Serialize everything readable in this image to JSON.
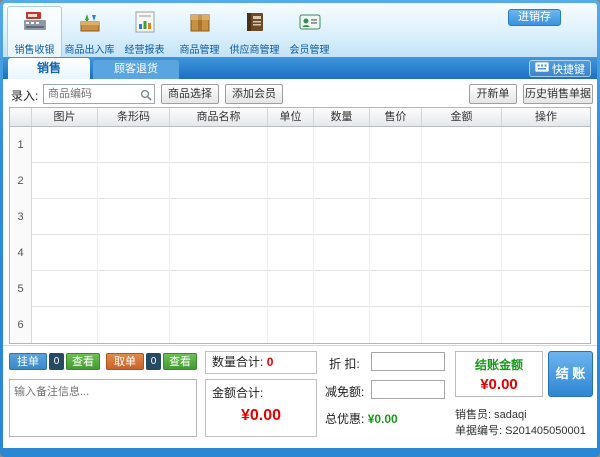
{
  "titlebar": {
    "inventory_button": "进销存"
  },
  "toolbar": {
    "items": [
      {
        "label": "销售收银",
        "icon": "cash-register-icon"
      },
      {
        "label": "商品出入库",
        "icon": "stock-inout-icon"
      },
      {
        "label": "经营报表",
        "icon": "report-icon"
      },
      {
        "label": "商品管理",
        "icon": "product-box-icon"
      },
      {
        "label": "供应商管理",
        "icon": "supplier-icon"
      },
      {
        "label": "会员管理",
        "icon": "member-card-icon"
      }
    ]
  },
  "tabs": {
    "sales": "销售",
    "returns": "顾客退货",
    "shortcut": "快捷键"
  },
  "entry": {
    "label": "录入:",
    "placeholder": "商品编码",
    "select_product": "商品选择",
    "add_member": "添加会员",
    "new_order": "开新单",
    "history": "历史销售单据"
  },
  "table": {
    "headers": [
      "图片",
      "条形码",
      "商品名称",
      "单位",
      "数量",
      "售价",
      "金额",
      "操作"
    ],
    "row_numbers": [
      "1",
      "2",
      "3",
      "4",
      "5",
      "6"
    ]
  },
  "footer": {
    "hold": {
      "label": "挂单",
      "count": "0",
      "view": "查看"
    },
    "retrieve": {
      "label": "取单",
      "count": "0",
      "view": "查看"
    },
    "remark_placeholder": "输入备注信息...",
    "qty_total_label": "数量合计:",
    "qty_total_value": "0",
    "amount_total_label": "金额合计:",
    "amount_total_value": "¥0.00",
    "discount_label": "折 扣:",
    "discount_value": "",
    "deduction_label": "减免额:",
    "deduction_value": "",
    "promo_label": "总优惠:",
    "promo_value": "¥0.00",
    "checkout_label": "结账金额",
    "checkout_value": "¥0.00",
    "checkout_button": "结 账",
    "salesperson_label": "销售员:",
    "salesperson_value": "sadaqi",
    "doc_label": "单据编号:",
    "doc_value": "S201405050001"
  },
  "colors": {
    "frame_blue": "#2e8bd8",
    "tabstrip_blue": "#1e6fc0",
    "accent_red": "#e60000",
    "accent_green": "#1a9a1a",
    "hold_blue": "#3b86c8",
    "retrieve_orange": "#c8622a",
    "view_green": "#449a33"
  }
}
